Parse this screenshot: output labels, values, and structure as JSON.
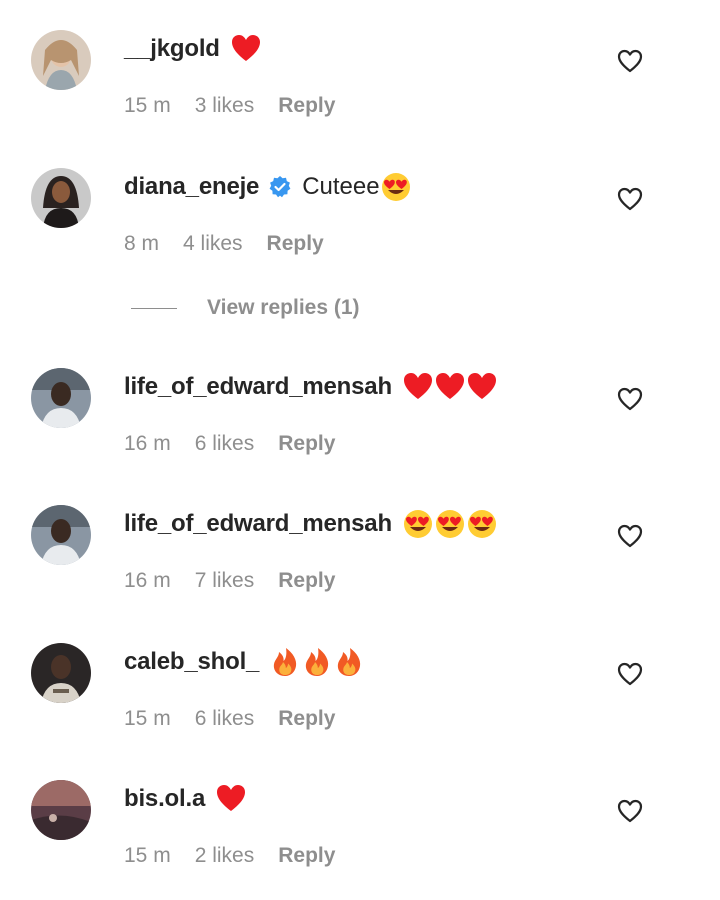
{
  "comments": [
    {
      "username": "__jkgold",
      "text": "",
      "emojis": [
        "red-heart"
      ],
      "time": "15 m",
      "likes": "3 likes",
      "reply": "Reply",
      "verified": false,
      "avatar_color": "#c9b6a6"
    },
    {
      "username": "diana_eneje",
      "text": "Cuteee",
      "emojis": [
        "heart-eyes"
      ],
      "time": "8 m",
      "likes": "4 likes",
      "reply": "Reply",
      "verified": true,
      "avatar_color": "#3a3433"
    },
    {
      "username": "life_of_edward_mensah",
      "text": "",
      "emojis": [
        "red-heart",
        "red-heart",
        "red-heart"
      ],
      "time": "16 m",
      "likes": "6 likes",
      "reply": "Reply",
      "verified": false,
      "avatar_color": "#6d7a8a"
    },
    {
      "username": "life_of_edward_mensah",
      "text": "",
      "emojis": [
        "heart-eyes",
        "heart-eyes",
        "heart-eyes"
      ],
      "time": "16 m",
      "likes": "7 likes",
      "reply": "Reply",
      "verified": false,
      "avatar_color": "#6d7a8a"
    },
    {
      "username": "caleb_shol_",
      "text": "",
      "emojis": [
        "fire",
        "fire",
        "fire"
      ],
      "time": "15 m",
      "likes": "6 likes",
      "reply": "Reply",
      "verified": false,
      "avatar_color": "#2f2a2a"
    },
    {
      "username": "bis.ol.a",
      "text": "",
      "emojis": [
        "red-heart"
      ],
      "time": "15 m",
      "likes": "2 likes",
      "reply": "Reply",
      "verified": false,
      "avatar_color": "#6b4a52"
    }
  ],
  "view_replies": {
    "label": "View replies (1)"
  },
  "icons": {
    "like": "heart-outline-icon",
    "verified": "verified-badge-icon"
  },
  "colors": {
    "text": "#262626",
    "secondary": "#8e8e8e",
    "verified": "#3897f0",
    "heart": "#ed1c24"
  }
}
